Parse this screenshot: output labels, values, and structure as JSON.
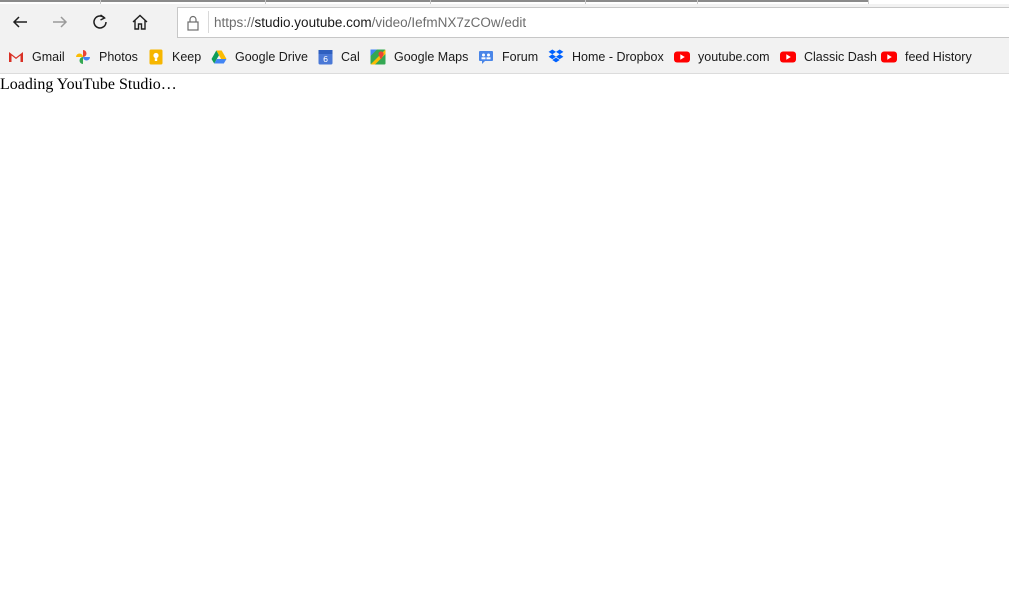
{
  "browser": {
    "address": {
      "scheme": "https://",
      "host": "studio.youtube.com",
      "path": "/video/IefmNX7zCOw/edit"
    },
    "nav": {
      "back_icon": "arrow-left-icon",
      "forward_icon": "arrow-right-icon",
      "reload_icon": "reload-icon",
      "home_icon": "home-icon",
      "lock_icon": "lock-icon"
    },
    "bookmarks": [
      {
        "label": "Gmail",
        "icon": "gmail-icon"
      },
      {
        "label": "Photos",
        "icon": "photos-icon"
      },
      {
        "label": "Keep",
        "icon": "keep-icon"
      },
      {
        "label": "Google Drive",
        "icon": "drive-icon"
      },
      {
        "label": "Cal",
        "icon": "calendar-icon"
      },
      {
        "label": "Google Maps",
        "icon": "maps-icon"
      },
      {
        "label": "Forum",
        "icon": "forum-icon"
      },
      {
        "label": "Home - Dropbox",
        "icon": "dropbox-icon"
      },
      {
        "label": "youtube.com",
        "icon": "youtube-icon"
      },
      {
        "label": "Classic Dash",
        "icon": "youtube-icon"
      },
      {
        "label": "feed History",
        "icon": "youtube-icon"
      }
    ],
    "calendar_icon_day": "6"
  },
  "page": {
    "loading_text": "Loading YouTube Studio…"
  },
  "colors": {
    "chrome_bg": "#f2f2f2",
    "youtube_red": "#ff0000",
    "dropbox_blue": "#0061fe"
  }
}
